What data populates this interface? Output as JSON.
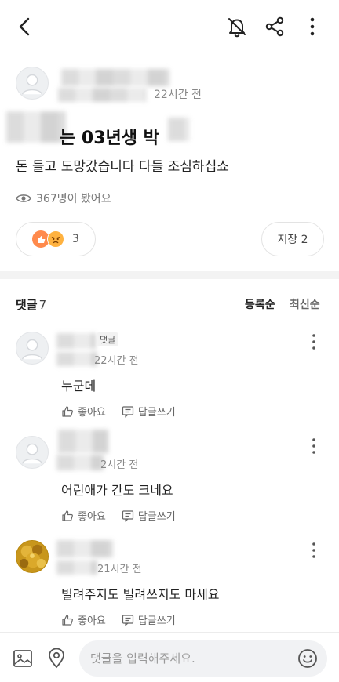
{
  "header": {
    "icons": [
      "back-icon",
      "bell-off-icon",
      "share-icon",
      "more-vertical-icon"
    ]
  },
  "post": {
    "time": "22시간 전",
    "title_visible": "는 03년생 박",
    "body": "돈 들고 도망갔습니다 다들 조심하십쇼",
    "views": "367명이 봤어요",
    "reaction_count": "3",
    "save_label": "저장 2"
  },
  "comments_section": {
    "label": "댓글",
    "count": "7",
    "sort_registered": "등록순",
    "sort_latest": "최신순"
  },
  "comments": [
    {
      "tag": "댓글",
      "time": "22시간 전",
      "text": "누군데",
      "like_label": "좋아요",
      "reply_label": "답글쓰기"
    },
    {
      "time": "2시간 전",
      "text": "어린애가 간도 크네요",
      "like_label": "좋아요",
      "reply_label": "답글쓰기"
    },
    {
      "time": "21시간 전",
      "text": "빌려주지도 빌려쓰지도 마세요",
      "like_label": "좋아요",
      "reply_label": "답글쓰기"
    }
  ],
  "composer": {
    "placeholder": "댓글을 입력해주세요."
  },
  "colors": {
    "like_emoji": "#ff8a4c",
    "angry_emoji": "#ffb23f",
    "divider": "#f3f3f3"
  }
}
